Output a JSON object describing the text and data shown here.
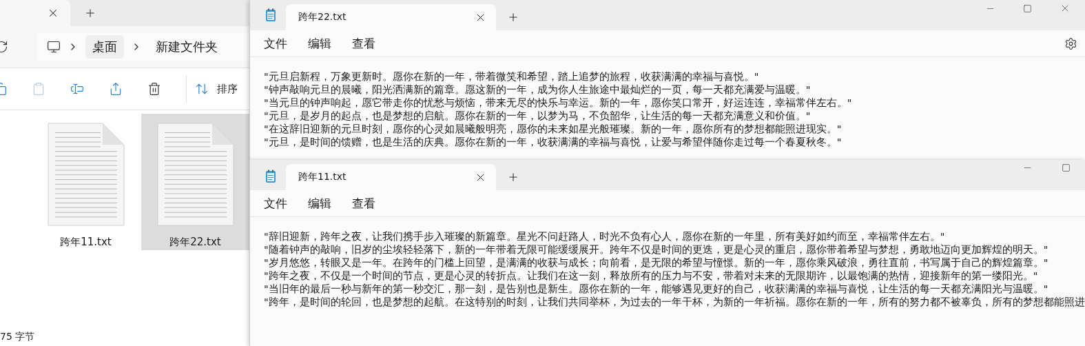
{
  "explorer": {
    "breadcrumb": [
      "桌面",
      "新建文件夹"
    ],
    "sort_label": "排序",
    "files": [
      {
        "name": "跨年11.txt",
        "selected": false
      },
      {
        "name": "跨年22.txt",
        "selected": true
      }
    ],
    "status": "75 字节"
  },
  "notepads": [
    {
      "title": "跨年22.txt",
      "menu": [
        "文件",
        "编辑",
        "查看"
      ],
      "lines": [
        "\"元旦启新程，万象更新时。愿你在新的一年，带着微笑和希望，踏上追梦的旅程，收获满满的幸福与喜悦。\"",
        "\"钟声敲响元旦的晨曦，阳光洒满新的篇章。愿这新的一年，成为你人生旅途中最灿烂的一页，每一天都充满爱与温暖。\"",
        "\"当元旦的钟声响起，愿它带走你的忧愁与烦恼，带来无尽的快乐与幸运。新的一年，愿你笑口常开，好运连连，幸福常伴左右。\"",
        "\"元旦，是岁月的起点，也是梦想的启航。愿你在新的一年，以梦为马，不负韶华，让生活的每一天都充满意义和价值。\"",
        "\"在这辞旧迎新的元旦时刻，愿你的心灵如晨曦般明亮，愿你的未来如星光般璀璨。新的一年，愿你所有的梦想都能照进现实。\"",
        "\"元旦，是时间的馈赠，也是生活的庆典。愿你在新的一年，收获满满的幸福与喜悦，让爱与希望伴随你走过每一个春夏秋冬。\""
      ]
    },
    {
      "title": "跨年11.txt",
      "menu": [
        "文件",
        "编辑",
        "查看"
      ],
      "lines": [
        "\"辞旧迎新，跨年之夜，让我们携手步入璀璨的新篇章。星光不问赶路人，时光不负有心人，愿你在新的一年里，所有美好如约而至，幸福常伴左右。\"",
        "\"随着钟声的敲响，旧岁的尘埃轻轻落下，新的一年带着无限可能缓缓展开。跨年不仅是时间的更迭，更是心灵的重启，愿你带着希望与梦想，勇敢地迈向更加辉煌的明天。\"",
        "\"岁月悠悠，转眼又是一年。在跨年的门槛上回望，是满满的收获与成长；向前看，是无限的希望与憧憬。新的一年，愿你乘风破浪，勇往直前，书写属于自己的辉煌篇章。\"",
        "\"跨年之夜，不仅是一个时间的节点，更是心灵的转折点。让我们在这一刻，释放所有的压力与不安，带着对未来的无限期许，以最饱满的热情，迎接新年的第一缕阳光。\"",
        "\"当旧年的最后一秒与新年的第一秒交汇，那一刻，是告别也是新生。愿你在新的一年，能够遇见更好的自己，收获满满的幸福与喜悦，让生活的每一天都充满阳光与温暖。\"",
        "\"跨年，是时间的轮回，也是梦想的起航。在这特别的时刻，让我们共同举杯，为过去的一年干杯，为新的一年祈福。愿你在新的一年，所有的努力都不被辜负，所有的梦想都能照进"
      ]
    }
  ]
}
